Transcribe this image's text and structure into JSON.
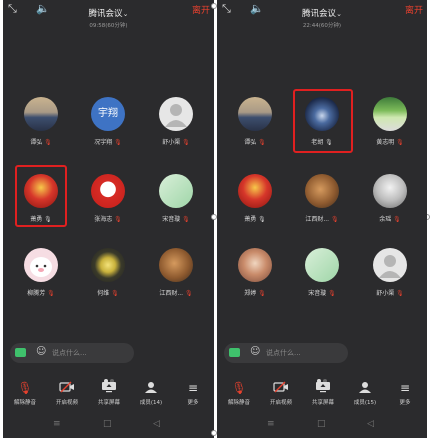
{
  "left": {
    "title": "腾讯会议",
    "timer": "09:58(60分钟)",
    "leave_label": "离开",
    "participants": [
      {
        "name": "谭弘",
        "muted": true
      },
      {
        "name": "况宇翔",
        "muted": true,
        "avatar_text": "宇翔"
      },
      {
        "name": "舒小渠",
        "muted": true
      },
      {
        "name": "萧勇",
        "muted": false
      },
      {
        "name": "张海志",
        "muted": true
      },
      {
        "name": "宋音璇",
        "muted": true
      },
      {
        "name": "柳腾芳",
        "muted": true
      },
      {
        "name": "何维",
        "muted": true
      },
      {
        "name": "江西财...",
        "muted": true
      }
    ],
    "chat_placeholder": "说点什么...",
    "toolbar": [
      {
        "label": "解除静音",
        "icon": "mic-muted-icon"
      },
      {
        "label": "开启视频",
        "icon": "video-off-icon"
      },
      {
        "label": "共享屏幕",
        "icon": "screen-share-icon"
      },
      {
        "label": "成员(14)",
        "icon": "members-icon"
      },
      {
        "label": "更多",
        "icon": "more-icon"
      }
    ]
  },
  "right": {
    "title": "腾讯会议",
    "timer": "22:44(60分钟)",
    "leave_label": "离开",
    "participants": [
      {
        "name": "谭弘",
        "muted": true
      },
      {
        "name": "老胡",
        "muted": false
      },
      {
        "name": "黄志明",
        "muted": true
      },
      {
        "name": "萧勇",
        "muted": false
      },
      {
        "name": "江西财...",
        "muted": true
      },
      {
        "name": "余瑶",
        "muted": true
      },
      {
        "name": "郑婷",
        "muted": true
      },
      {
        "name": "宋音璇",
        "muted": true
      },
      {
        "name": "舒小渠",
        "muted": true
      }
    ],
    "chat_placeholder": "说点什么...",
    "toolbar": [
      {
        "label": "解除静音",
        "icon": "mic-muted-icon"
      },
      {
        "label": "开启视频",
        "icon": "video-off-icon"
      },
      {
        "label": "共享屏幕",
        "icon": "screen-share-icon"
      },
      {
        "label": "成员(15)",
        "icon": "members-icon"
      },
      {
        "label": "更多",
        "icon": "more-icon"
      }
    ]
  },
  "colors": {
    "background": "#2b2b2d",
    "leave": "#e8412e",
    "highlight": "#e02020",
    "chat_accent": "#3fc16c"
  }
}
